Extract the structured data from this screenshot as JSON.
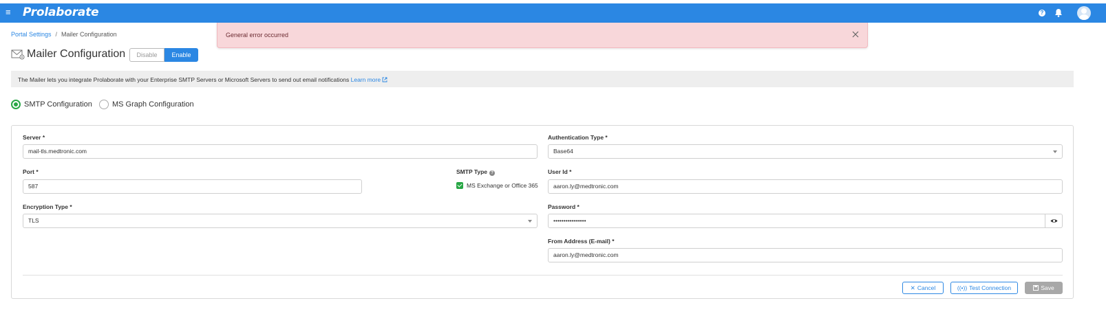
{
  "app": {
    "brand": "Prolaborate"
  },
  "breadcrumb": {
    "parent": "Portal Settings",
    "separator": "/",
    "current": "Mailer Configuration"
  },
  "toast": {
    "message": "General error occurred"
  },
  "page": {
    "title": "Mailer Configuration",
    "toggle_disable": "Disable",
    "toggle_enable": "Enable"
  },
  "info": {
    "text": "The Mailer lets you integrate Prolaborate with your Enterprise SMTP Servers or Microsoft Servers to send out email notifications",
    "link": "Learn more"
  },
  "radios": {
    "smtp": "SMTP Configuration",
    "msgraph": "MS Graph Configuration",
    "selected": "smtp"
  },
  "form": {
    "server_label": "Server *",
    "server_value": "mail-tls.medtronic.com",
    "port_label": "Port *",
    "port_value": "587",
    "encryption_label": "Encryption Type *",
    "encryption_value": "TLS",
    "smtp_type_label": "SMTP Type",
    "smtp_type_option": "MS Exchange or Office 365",
    "auth_label": "Authentication Type *",
    "auth_value": "Base64",
    "userid_label": "User Id *",
    "userid_value": "aaron.ly@medtronic.com",
    "password_label": "Password *",
    "password_value": "••••••••••••••••",
    "from_label": "From Address (E-mail) *",
    "from_value": "aaron.ly@medtronic.com"
  },
  "actions": {
    "cancel": "Cancel",
    "test": "Test Connection",
    "save": "Save"
  },
  "colors": {
    "primary": "#2b87e3",
    "success": "#28a745",
    "error_bg": "#f8d7da"
  }
}
